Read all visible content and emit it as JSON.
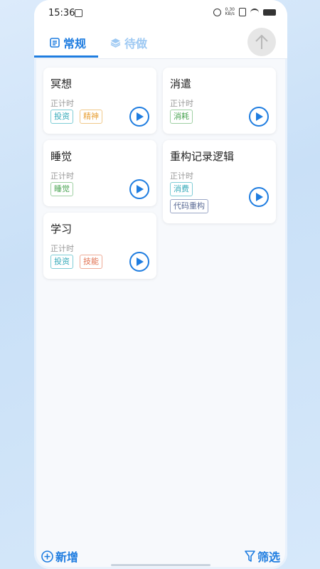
{
  "status": {
    "time": "15:36",
    "net_speed": "0.30\nKB/s"
  },
  "tabs": [
    {
      "label": "常规",
      "active": true,
      "icon": "list-icon"
    },
    {
      "label": "待做",
      "active": false,
      "icon": "layers-icon"
    }
  ],
  "cards": [
    {
      "title": "冥想",
      "subtitle": "正计时",
      "tags": [
        "投资",
        "精神"
      ]
    },
    {
      "title": "消遣",
      "subtitle": "正计时",
      "tags": [
        "消耗"
      ]
    },
    {
      "title": "睡觉",
      "subtitle": "正计时",
      "tags": [
        "睡觉"
      ]
    },
    {
      "title": "重构记录逻辑",
      "subtitle": "正计时",
      "tags": [
        "消费",
        "代码重构"
      ]
    },
    {
      "title": "学习",
      "subtitle": "正计时",
      "tags": [
        "投资",
        "技能"
      ]
    }
  ],
  "bottom": {
    "add_label": "新增",
    "filter_label": "筛选"
  },
  "colors": {
    "accent": "#1f7de0",
    "tab_inactive": "#9ec9f3"
  }
}
